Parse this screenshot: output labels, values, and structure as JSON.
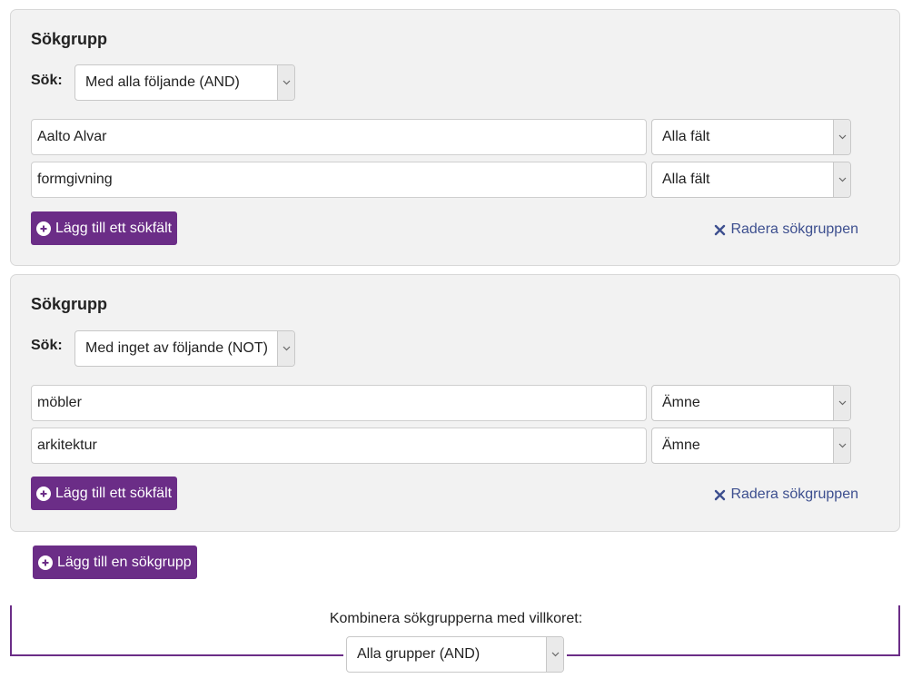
{
  "groups": [
    {
      "title": "Sökgrupp",
      "sok_label": "Sök:",
      "operator": "Med alla följande (AND)",
      "fields": [
        {
          "value": "Aalto Alvar",
          "field_type": "Alla fält"
        },
        {
          "value": "formgivning",
          "field_type": "Alla fält"
        }
      ],
      "add_field_label": "Lägg till ett sökfält",
      "delete_label": "Radera sökgruppen"
    },
    {
      "title": "Sökgrupp",
      "sok_label": "Sök:",
      "operator": "Med inget av följande (NOT)",
      "fields": [
        {
          "value": "möbler",
          "field_type": "Ämne"
        },
        {
          "value": "arkitektur",
          "field_type": "Ämne"
        }
      ],
      "add_field_label": "Lägg till ett sökfält",
      "delete_label": "Radera sökgruppen"
    }
  ],
  "add_group_label": "Lägg till en sökgrupp",
  "combine": {
    "label": "Kombinera sökgrupperna med villkoret:",
    "value": "Alla grupper (AND)"
  },
  "colors": {
    "accent": "#6b2d87",
    "link": "#3d4f8f",
    "panel": "#f2f2f2"
  },
  "icons": {
    "add": "plus-circle-icon",
    "delete": "close-x-icon",
    "dropdown": "chevron-down-icon"
  }
}
